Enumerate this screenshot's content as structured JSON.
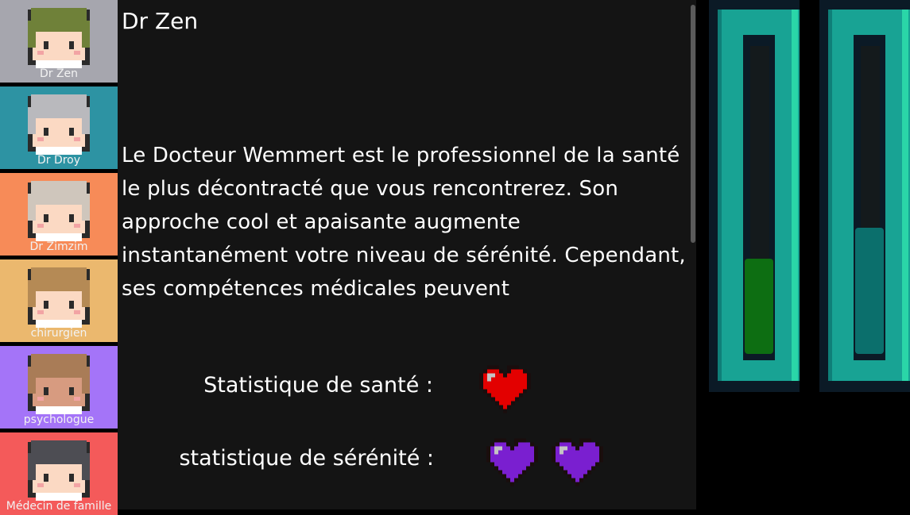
{
  "characters": [
    {
      "name": "Dr Zen",
      "bg": "#a6a6ae",
      "hair": "#6f8139",
      "skin": "#fbd9c3",
      "selected": true
    },
    {
      "name": "Dr Droy",
      "bg": "#2d93a3",
      "hair": "#b9b9bd",
      "skin": "#fbd9c3"
    },
    {
      "name": "Dr Zimzim",
      "bg": "#f78b58",
      "hair": "#cfc6bc",
      "skin": "#fbd9c3"
    },
    {
      "name": "chirurgien",
      "bg": "#ebb86e",
      "hair": "#b58a55",
      "skin": "#fbd9c3"
    },
    {
      "name": "psychologue",
      "bg": "#a474f8",
      "hair": "#a97c57",
      "skin": "#d79b80"
    },
    {
      "name": "Médecin de famille",
      "bg": "#f45a5a",
      "hair": "#4d4d53",
      "skin": "#fbd9c3"
    }
  ],
  "detail": {
    "name": "Dr Zen",
    "description": "Le Docteur Wemmert est le professionnel de la santé le plus décontracté que vous rencontrerez. Son approche cool et apaisante augmente instantanément votre niveau de sérénité. Cependant, ses compétences médicales peuvent",
    "health_label": "Statistique de santé :",
    "serenity_label": "statistique de sérénité :",
    "health_hearts": 1,
    "serenity_hearts": 2,
    "health_color": "#e30000",
    "serenity_color": "#7a1fd0"
  },
  "gauges": [
    {
      "level": 0.31,
      "fill": "#0d6e12",
      "frame": "#18a394"
    },
    {
      "level": 0.41,
      "fill": "#0b6f6c",
      "frame": "#18a394"
    }
  ]
}
